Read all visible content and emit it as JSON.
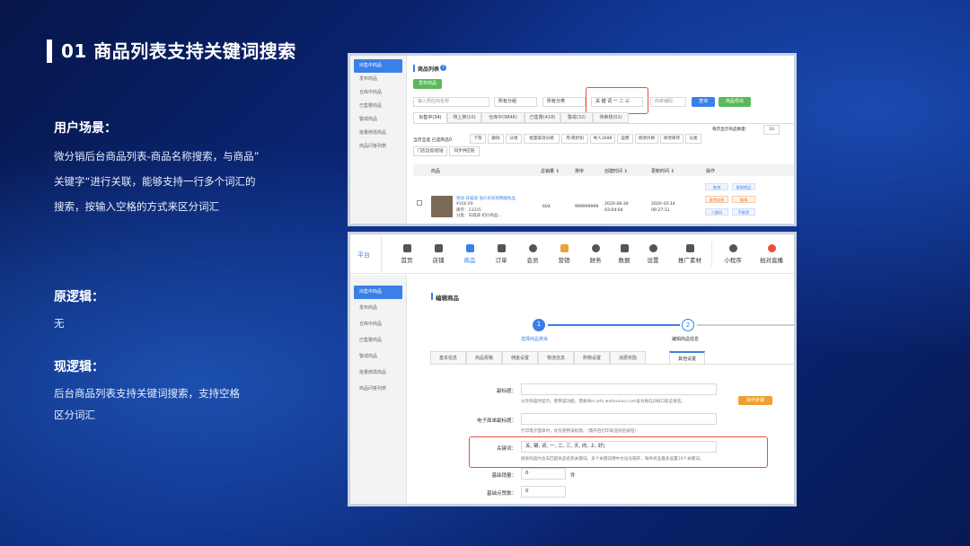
{
  "slide": {
    "title": "01 商品列表支持关键词搜索",
    "scene_title": "用户场景：",
    "scene_lines": [
      "微分销后台商品列表-商品名称搜索，与商品”",
      "关键字“进行关联，能够支持一行多个词汇的",
      "搜索，按输入空格的方式来区分词汇"
    ],
    "old_title": "原逻辑：",
    "old_text": "无",
    "new_title": "现逻辑：",
    "new_lines": [
      "后台商品列表支持关键词搜索，支持空格",
      "区分词汇"
    ]
  },
  "shot1": {
    "sidebar": [
      "出售中商品",
      "发布商品",
      "仓库中商品",
      "已售罄商品",
      "警戒商品",
      "批量修改商品",
      "商品问答列表"
    ],
    "header": "商品列表",
    "publish_btn": "发布商品",
    "name_placeholder": "输入供应商名称",
    "cat1": "所有分组",
    "cat2": "所有分类",
    "keyword": "关 键 词 一 二 三",
    "code_placeholder": "商家编码",
    "query_btn": "查询",
    "export_btn": "商品导出",
    "tabs": [
      "出售中(34)",
      "待上架(10)",
      "仓库中(9846)",
      "已售罄(418)",
      "警戒(32)",
      "待审核(01)"
    ],
    "page_size": "每页显示商品数量：",
    "page_size_val": "10",
    "select_all": "当页全选  已选商品0",
    "tools": [
      "下架",
      "删除",
      "分组",
      "批量取消分组",
      "月/夜折扣",
      "导入1688",
      "运费",
      "修改价格",
      "修改库存",
      "分类"
    ],
    "tools2": [
      "门店自提/配送",
      "同步供应链"
    ],
    "columns": [
      "商品",
      "总销量 ↕",
      "排序",
      "创建时间 ↕",
      "更新时间 ↕",
      "操作"
    ],
    "row": {
      "name": "现动 日威减 低价买初现铁腿商品",
      "price": "¥166.69",
      "stock": "库存：23335",
      "group": "分类：日威减 初价商品...",
      "sales": "604",
      "sort": "999999999",
      "created": "2020-08-30 03:04:04",
      "updated": "2020-10-14 09:27:11",
      "ops": [
        "查询",
        "复制商品",
        "复制链接",
        "编辑",
        "二维码",
        "不推荐"
      ]
    }
  },
  "shot2": {
    "logo": "平台",
    "nav": [
      "首页",
      "店铺",
      "商品",
      "订单",
      "会员",
      "营销",
      "财务",
      "数据",
      "设置",
      "推广素材",
      "小程序",
      "拍对直播"
    ],
    "nav_colors": [
      "#555",
      "#555",
      "#3b7fe8",
      "#555",
      "#555",
      "#e8a33a",
      "#555",
      "#555",
      "#555",
      "#555",
      "#555",
      "#e8503a"
    ],
    "sidebar": [
      "出售中商品",
      "发布商品",
      "仓库中商品",
      "已售罄商品",
      "警戒商品",
      "批量修改商品",
      "商品问答列表"
    ],
    "header": "编辑商品",
    "step1": "1",
    "step1_label": "选择商品类目",
    "step2": "2",
    "step2_label": "编辑商品信息",
    "tabs": [
      "基本信息",
      "商品规格",
      "佣金设置",
      "物流信息",
      "购物设置",
      "消费奖励",
      "其他设置"
    ],
    "subtitle_label": "副标题：",
    "subtitle_hint": "分享商品时显示。使用该功能，需要将m.wfx.wxfenxiao.com设为微信JS接口安全域名。",
    "subtitle_btn": "操作步骤",
    "einvoice_label": "电子面单副标题：",
    "einvoice_hint": "打印电子面单时，优先使用该标题。（需开启打印商品别名按钮）",
    "keyword_label": "关键词：",
    "keyword_value": "关, 键, 词, 一, 二, 三, 天, 向, 上, 好|",
    "keyword_hint": "搜索商品时会去匹配商品名和关键词。多个关键词用中文逗号隔开，每件商品最多设置10个关键词。",
    "sales_label": "基础销量：",
    "sales_value": "0",
    "sales_unit": "件",
    "likes_label": "基础点赞数：",
    "likes_value": "0"
  }
}
